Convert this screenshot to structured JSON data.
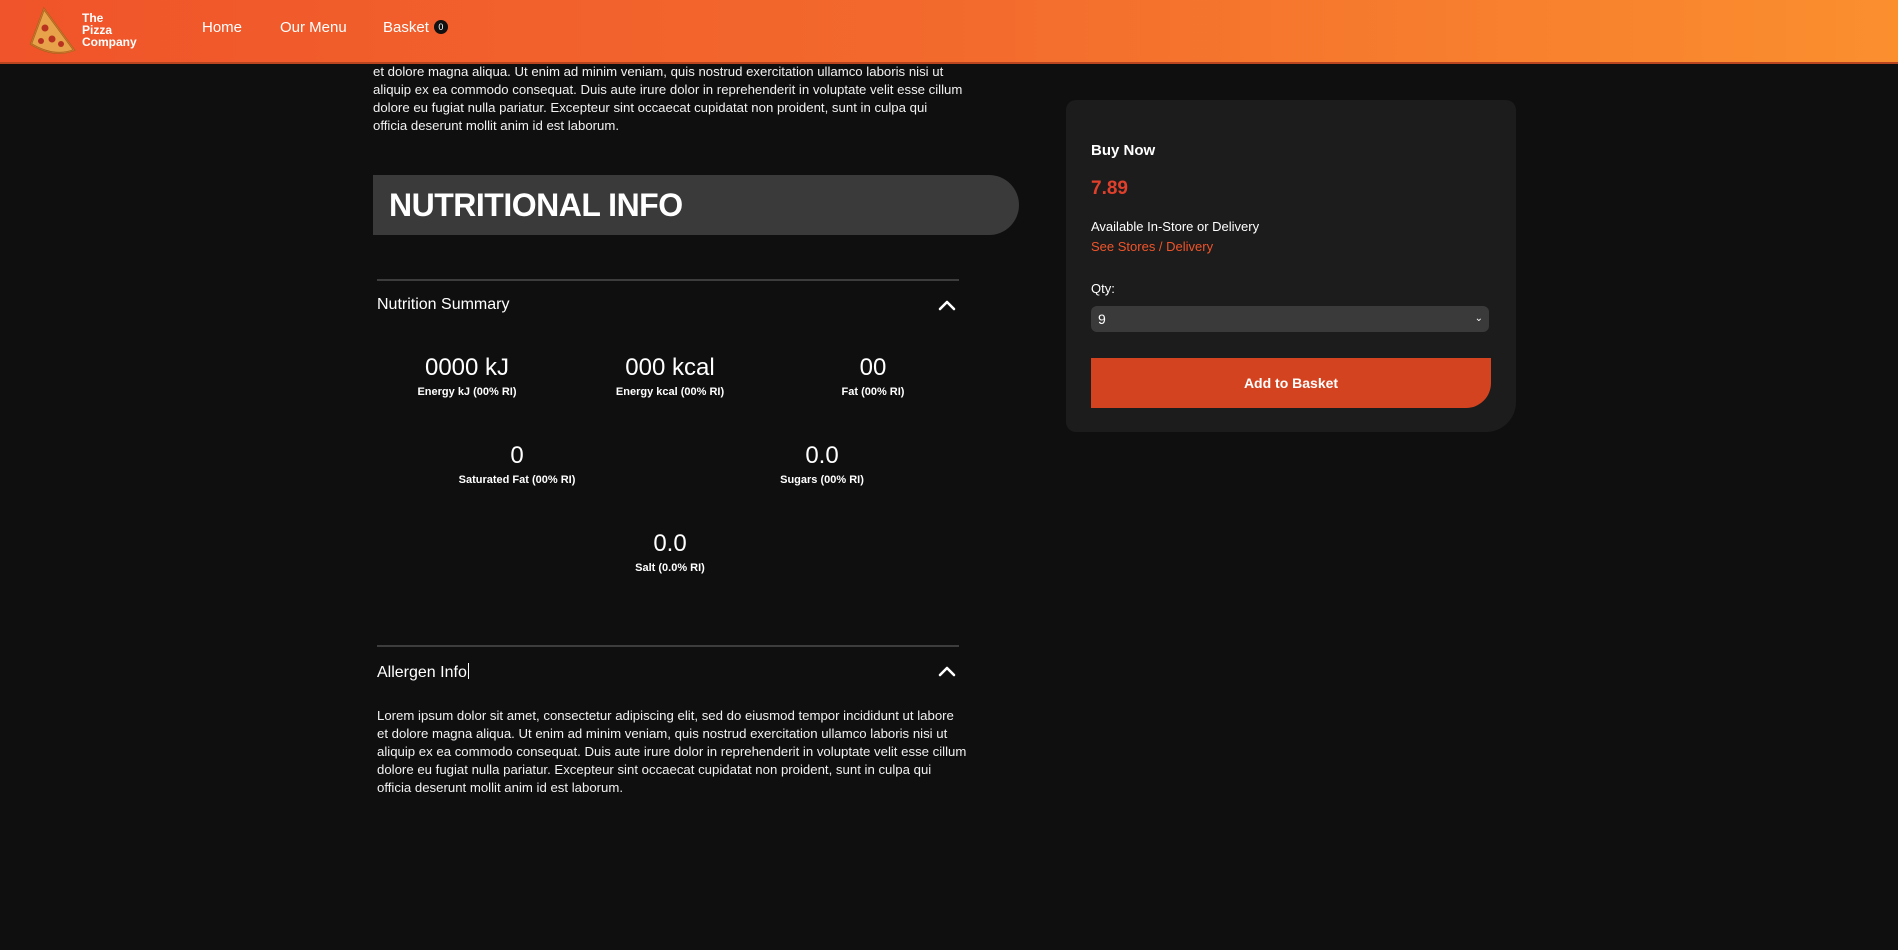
{
  "brand": {
    "logo_text": [
      "The",
      "Pizza",
      "Company"
    ],
    "accent": "#f0542a",
    "accent_end": "#fb8f2e"
  },
  "nav": {
    "home": "Home",
    "menu": "Our Menu",
    "basket": "Basket",
    "basket_count": "0"
  },
  "description_top": "et dolore magna aliqua. Ut enim ad minim veniam, quis nostrud exercitation ullamco laboris nisi ut aliquip ex ea commodo consequat. Duis aute irure dolor in reprehenderit in voluptate velit esse cillum dolore eu fugiat nulla pariatur. Excepteur sint occaecat cupidatat non proident, sunt in culpa qui officia deserunt mollit anim id est laborum.",
  "nutrition": {
    "heading": "NUTRITIONAL INFO",
    "summary_title": "Nutrition Summary",
    "stats": [
      {
        "value": "0000 kJ",
        "label": "Energy kJ (00% RI)"
      },
      {
        "value": "000 kcal",
        "label": "Energy kcal (00% RI)"
      },
      {
        "value": "00",
        "label": "Fat (00% RI)"
      },
      {
        "value": "0",
        "label": "Saturated Fat (00% RI)"
      },
      {
        "value": "0.0",
        "label": "Sugars (00% RI)"
      },
      {
        "value": "0.0",
        "label": "Salt (0.0% RI)"
      }
    ]
  },
  "allergen": {
    "title": "Allergen Info",
    "text": "Lorem ipsum dolor sit amet, consectetur adipiscing elit, sed do eiusmod tempor incididunt ut labore et dolore magna aliqua. Ut enim ad minim veniam, quis nostrud exercitation ullamco laboris nisi ut aliquip ex ea commodo consequat. Duis aute irure dolor in reprehenderit in voluptate velit esse cillum dolore eu fugiat nulla pariatur. Excepteur sint occaecat cupidatat non proident, sunt in culpa qui officia deserunt mollit anim id est laborum."
  },
  "buy": {
    "title": "Buy Now",
    "price": "7.89",
    "availability": "Available In-Store or Delivery",
    "stores_link": "See Stores / Delivery",
    "qty_label": "Qty:",
    "qty_value": "9",
    "add_button": "Add to Basket"
  }
}
